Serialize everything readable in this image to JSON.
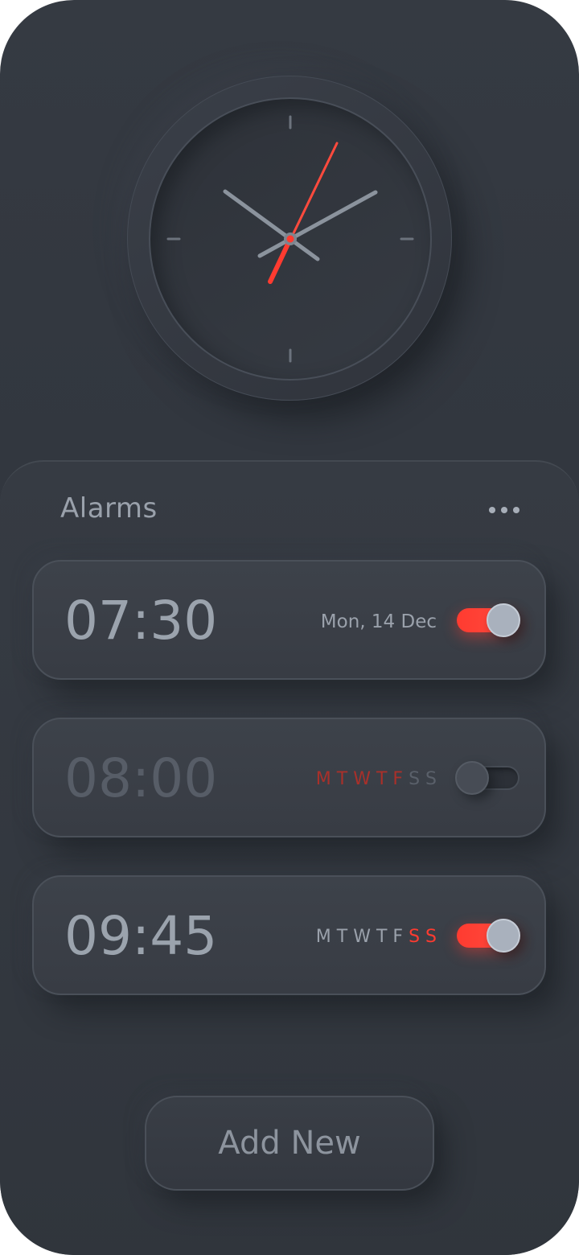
{
  "header": {
    "clock": {
      "hour_hand_color": "#8b939d",
      "minute_hand_color": "#8b939d",
      "second_hand_color": "#ff3b30",
      "tick_color": "#6c737d"
    }
  },
  "alarms_panel": {
    "title": "Alarms",
    "more_icon": "more-horizontal-icon",
    "alarms": [
      {
        "time": "07:30",
        "label": "Mon, 14 Dec",
        "enabled": true
      },
      {
        "time": "08:00",
        "days": [
          {
            "letter": "M",
            "active": true
          },
          {
            "letter": "T",
            "active": true
          },
          {
            "letter": "W",
            "active": true
          },
          {
            "letter": "T",
            "active": true
          },
          {
            "letter": "F",
            "active": true
          },
          {
            "letter": "S",
            "active": false
          },
          {
            "letter": "S",
            "active": false
          }
        ],
        "enabled": false
      },
      {
        "time": "09:45",
        "days": [
          {
            "letter": "M",
            "active": false
          },
          {
            "letter": "T",
            "active": false
          },
          {
            "letter": "W",
            "active": false
          },
          {
            "letter": "T",
            "active": false
          },
          {
            "letter": "F",
            "active": false
          },
          {
            "letter": "S",
            "active": true
          },
          {
            "letter": "S",
            "active": true
          }
        ],
        "enabled": true
      }
    ],
    "day_colors": {
      "active_enabled": "#ff3b30",
      "active_disabled": "#a8302a",
      "inactive_enabled": "#9aa1ab",
      "inactive_disabled": "#5a606a"
    }
  },
  "footer": {
    "add_label": "Add New"
  }
}
